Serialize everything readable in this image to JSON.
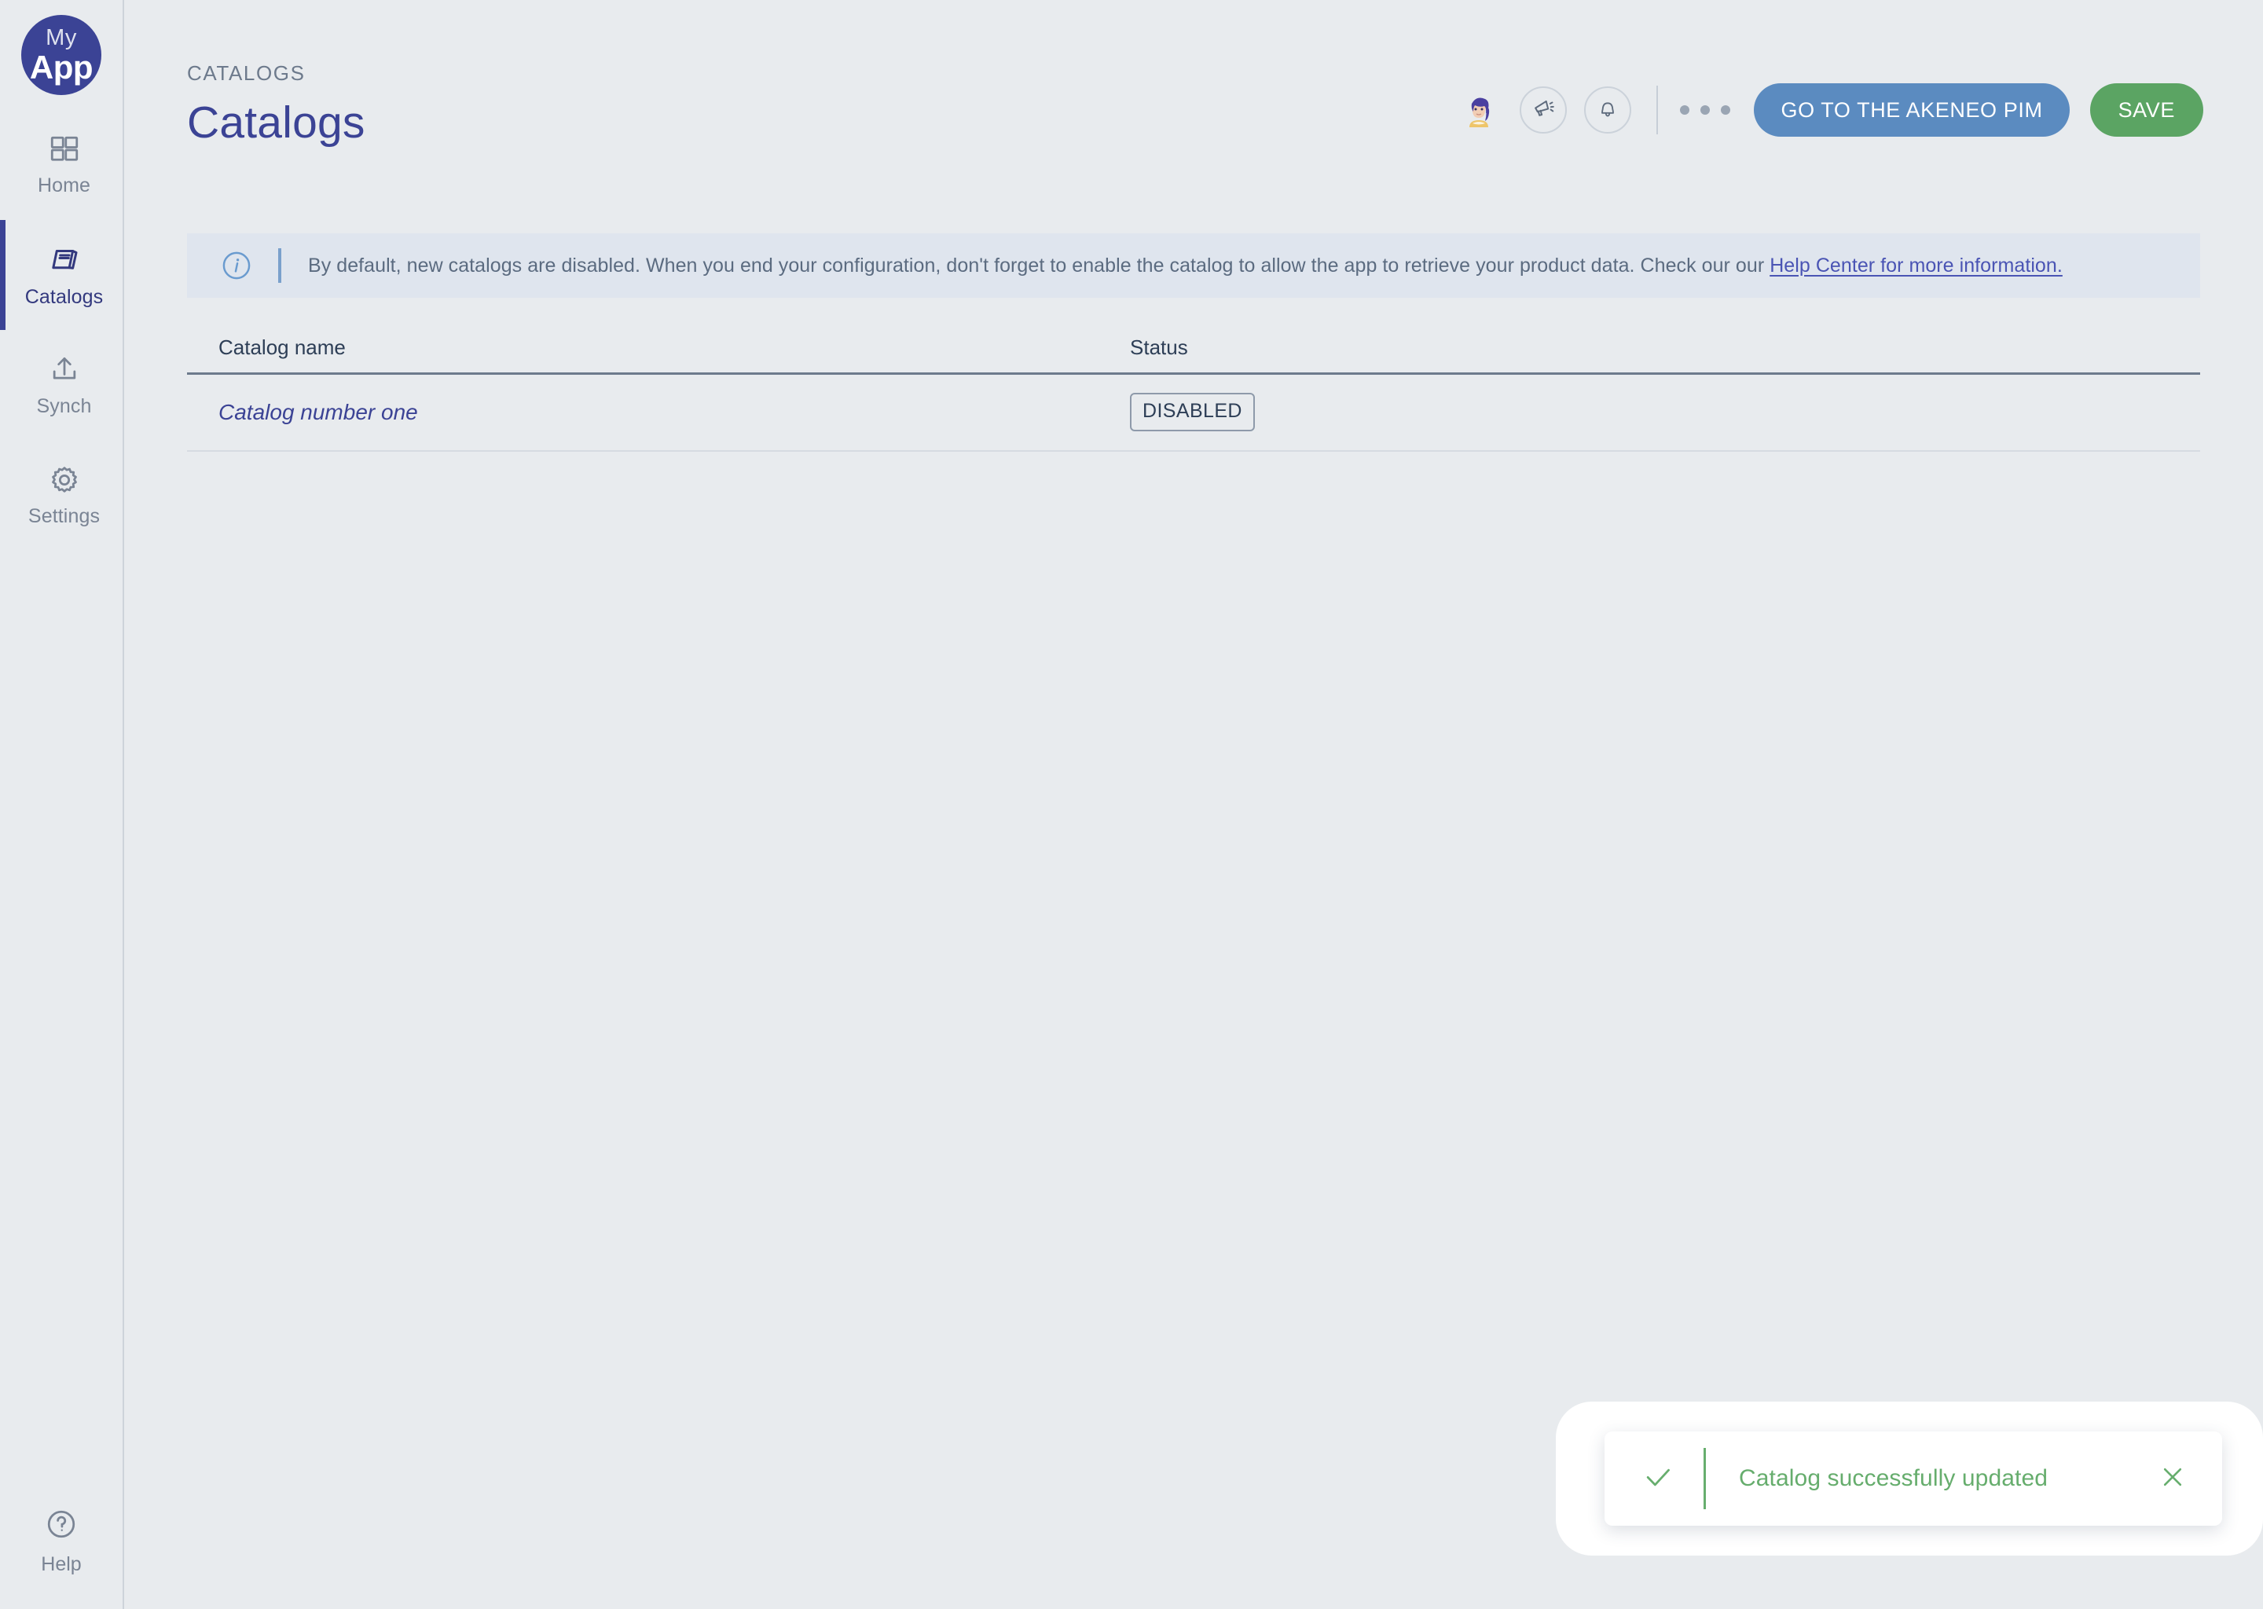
{
  "brand": {
    "logo_line1": "My",
    "logo_line2": "App",
    "logo_color": "#3b4395"
  },
  "sidebar": {
    "items": [
      {
        "id": "home",
        "label": "Home",
        "icon": "grid-icon",
        "active": false
      },
      {
        "id": "catalogs",
        "label": "Catalogs",
        "icon": "book-icon",
        "active": true
      },
      {
        "id": "synch",
        "label": "Synch",
        "icon": "upload-icon",
        "active": false
      },
      {
        "id": "settings",
        "label": "Settings",
        "icon": "gear-icon",
        "active": false
      }
    ],
    "help": {
      "label": "Help",
      "icon": "question-circle-icon"
    },
    "active_accent": "#3b4395"
  },
  "header": {
    "breadcrumb": "CATALOGS",
    "title": "Catalogs",
    "avatar_alt": "user-avatar",
    "announce_icon": "megaphone-icon",
    "notifications_icon": "bell-icon",
    "more_icon": "ellipsis-icon",
    "primary_button": "GO TO THE AKENEO PIM",
    "primary_button_color": "#5b8bc0",
    "save_button": "SAVE",
    "save_button_color": "#5ba463"
  },
  "banner": {
    "icon": "info-circle-icon",
    "text_before_link": "By default, new catalogs are disabled. When you end your configuration, don't forget to enable the catalog to allow the app to retrieve your product data. Check our our ",
    "link_text": "Help Center for more information.",
    "background": "#dfe5ee",
    "link_color": "#4a54b4"
  },
  "table": {
    "columns": [
      "Catalog name",
      "Status"
    ],
    "rows": [
      {
        "name": "Catalog number one",
        "status": "DISABLED"
      }
    ]
  },
  "toast": {
    "icon": "check-icon",
    "message": "Catalog successfully updated",
    "close_icon": "close-icon",
    "color": "#66ad6d"
  }
}
